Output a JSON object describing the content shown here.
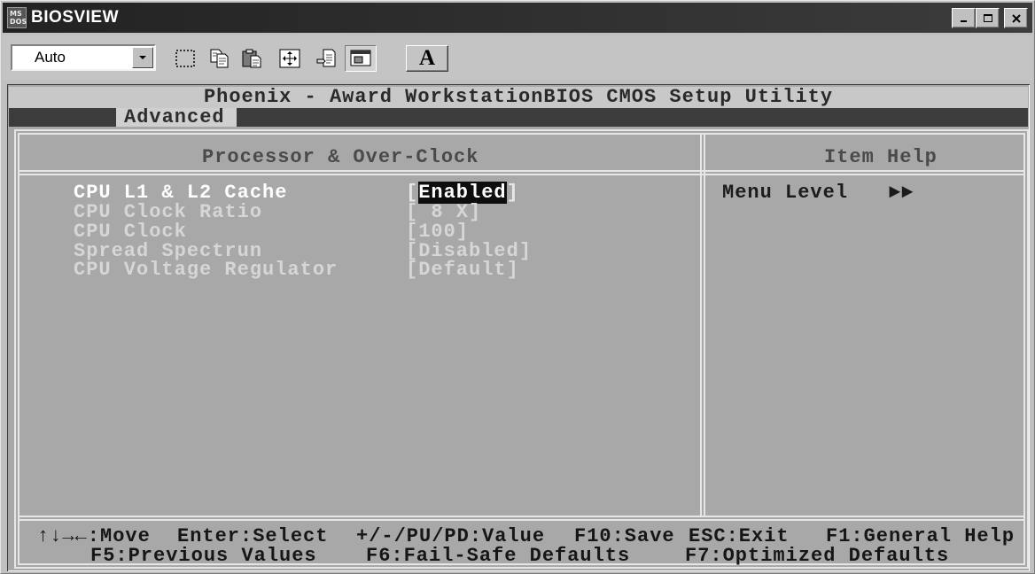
{
  "window": {
    "title": "BIOSVIEW",
    "app_icon": "ms-dos-icon",
    "app_icon_text": [
      "MS",
      "DOS"
    ],
    "controls": [
      "minimize-icon",
      "maximize-icon",
      "close-icon"
    ]
  },
  "toolbar": {
    "font_size_value": "Auto",
    "font_size_arrow_icon": "chevron-down-icon",
    "buttons": [
      "mark-icon",
      "copy-icon",
      "paste-icon",
      "full-screen-icon",
      "properties-icon",
      "background-icon"
    ],
    "font_button_label": "A"
  },
  "bios": {
    "title": "Phoenix - Award WorkstationBIOS CMOS Setup Utility",
    "active_menu": "Advanced",
    "left_heading": "Processor & Over-Clock",
    "right_heading": "Item Help",
    "bracket_open": "[",
    "bracket_close": "]",
    "items": [
      {
        "label": "CPU L1 & L2 Cache",
        "value": "Enabled",
        "selected": true
      },
      {
        "label": "CPU Clock Ratio",
        "value": " 8 X",
        "selected": false
      },
      {
        "label": "CPU Clock",
        "value": "100",
        "selected": false
      },
      {
        "label": "Spread Spectrun",
        "value": "Disabled",
        "selected": false
      },
      {
        "label": "CPU Voltage Regulator",
        "value": "Default",
        "selected": false
      }
    ],
    "help": {
      "menu_level_label": "Menu Level",
      "menu_level_marker": "►►"
    },
    "footer": {
      "line1": [
        "↑↓→←:Move",
        "Enter:Select",
        "+/-/PU/PD:Value",
        "F10:Save",
        "ESC:Exit",
        "F1:General Help"
      ],
      "line2": [
        "F5:Previous Values",
        "F6:Fail-Safe Defaults",
        "F7:Optimized Defaults"
      ]
    }
  },
  "colors": {
    "title_bar": "#222222",
    "terminal_bg": "#a8a8a8",
    "header_bg": "#c8c8c8",
    "menu_bar_bg": "#3c3c3c",
    "highlight_bg": "#0e0e0e",
    "line": "#e6e6e6"
  }
}
